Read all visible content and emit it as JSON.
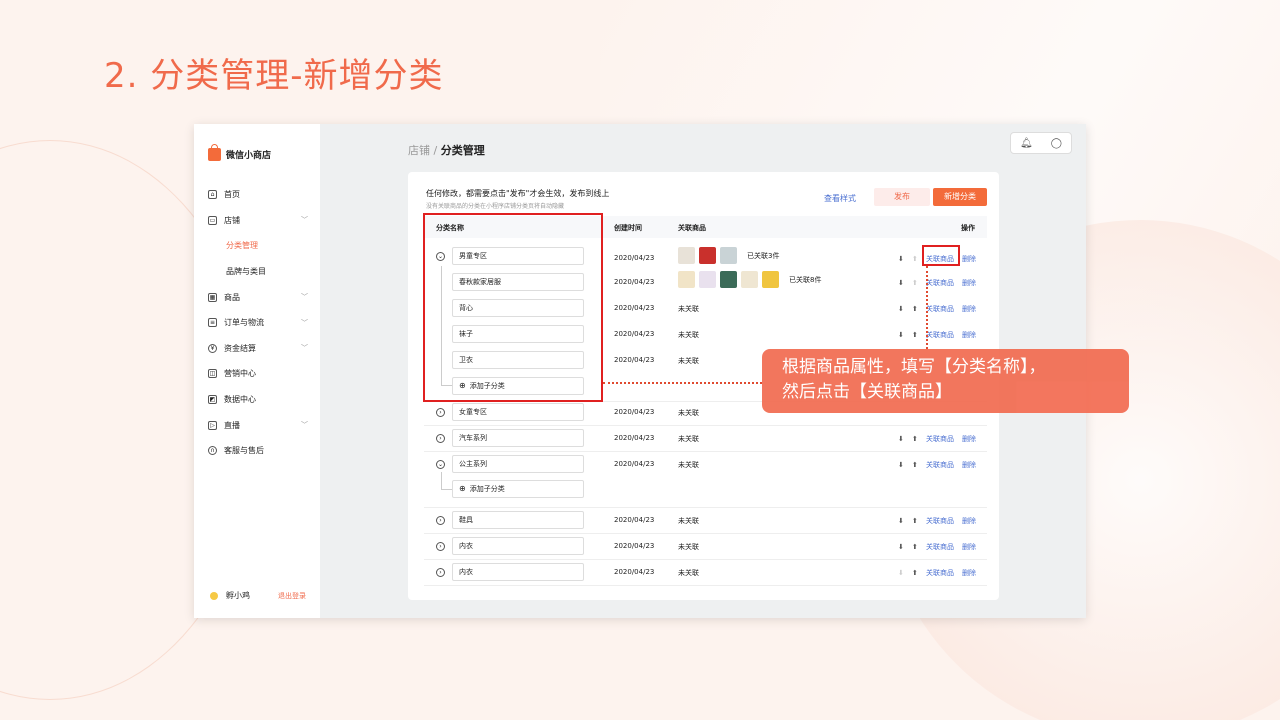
{
  "slide_title": "2. 分类管理-新增分类",
  "sidebar": {
    "brand": "微信小商店",
    "items": [
      {
        "label": "首页",
        "icon": "home-icon",
        "chevron": false
      },
      {
        "label": "店铺",
        "icon": "store-icon",
        "chevron": true
      },
      {
        "label": "分类管理",
        "sub": true,
        "active": true
      },
      {
        "label": "品牌与类目",
        "sub": true
      },
      {
        "label": "商品",
        "icon": "grid-icon",
        "chevron": true
      },
      {
        "label": "订单与物流",
        "icon": "order-icon",
        "chevron": true
      },
      {
        "label": "资金结算",
        "icon": "money-icon",
        "chevron": true
      },
      {
        "label": "营销中心",
        "icon": "marketing-icon"
      },
      {
        "label": "数据中心",
        "icon": "data-icon"
      },
      {
        "label": "直播",
        "icon": "live-icon",
        "chevron": true
      },
      {
        "label": "客服与售后",
        "icon": "headset-icon"
      }
    ],
    "user_name": "孵小鸡",
    "logout": "退出登录"
  },
  "breadcrumb": {
    "parent": "店铺",
    "sep": "/",
    "current": "分类管理"
  },
  "notice": {
    "main": "任何修改，都需要点击\"发布\"才会生效，发布到线上",
    "sub": "没有关联商品的分类在小程序店铺分类页将自动隐藏"
  },
  "actions": {
    "view_style": "查看样式",
    "publish": "发布",
    "add_category": "新增分类"
  },
  "table": {
    "headers": {
      "name": "分类名称",
      "created": "创建时间",
      "related": "关联商品",
      "ops": "操作"
    },
    "op_link": "关联商品",
    "op_delete": "删除",
    "add_sub": "添加子分类",
    "rows": [
      {
        "name": "男童专区",
        "date": "2020/04/23",
        "related": "已关联3件"
      },
      {
        "name": "春秋款家居服",
        "date": "2020/04/23",
        "related": "已关联8件"
      },
      {
        "name": "背心",
        "date": "2020/04/23",
        "related": "未关联"
      },
      {
        "name": "袜子",
        "date": "2020/04/23",
        "related": "未关联"
      },
      {
        "name": "卫衣",
        "date": "2020/04/23",
        "related": "未关联"
      },
      {
        "name": "女童专区",
        "date": "2020/04/23",
        "related": "未关联"
      },
      {
        "name": "汽车系列",
        "date": "2020/04/23",
        "related": "未关联"
      },
      {
        "name": "公主系列",
        "date": "2020/04/23",
        "related": "未关联"
      },
      {
        "name": "鞋具",
        "date": "2020/04/23",
        "related": "未关联"
      },
      {
        "name": "内衣",
        "date": "2020/04/23",
        "related": "未关联"
      },
      {
        "name": "内衣",
        "date": "2020/04/23",
        "related": "未关联"
      }
    ]
  },
  "callout": {
    "line1": "根据商品属性，填写【分类名称】，",
    "line2": "然后点击【关联商品】"
  },
  "colors": {
    "accent": "#f06a4b",
    "link": "#4a6fd1",
    "highlight": "#e02020"
  }
}
